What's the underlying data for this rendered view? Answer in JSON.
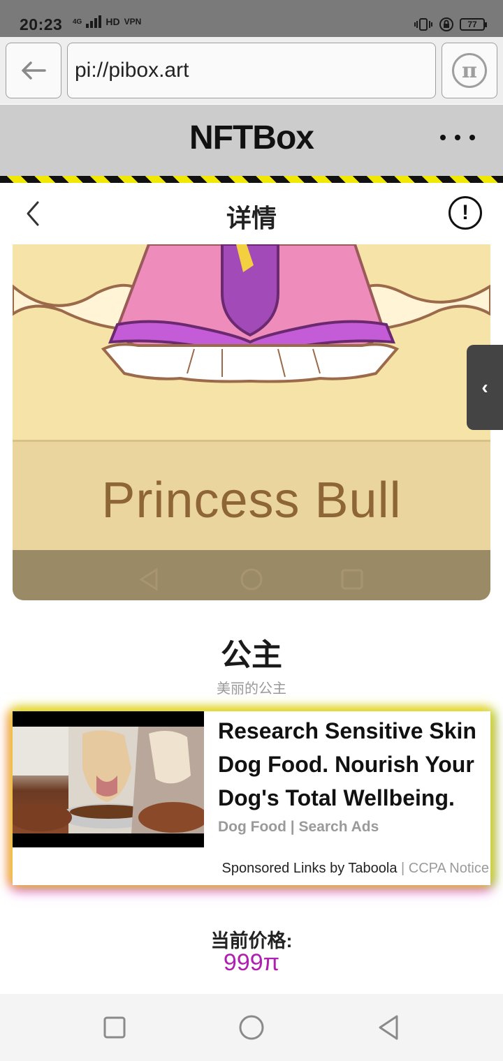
{
  "status_bar": {
    "time": "20:23",
    "network": "4G",
    "hd": "HD",
    "vpn": "VPN",
    "battery": "77"
  },
  "browser": {
    "url": "pi://pibox.art",
    "back_icon": "arrow-left-icon",
    "pi_icon": "pi-logo-icon",
    "pi_symbol": "π"
  },
  "app_header": {
    "title": "NFTBox",
    "more_icon": "more-dots-icon"
  },
  "page_header": {
    "title": "详情",
    "info_symbol": "!"
  },
  "nft": {
    "image_caption": "Princess Bull",
    "handle_symbol": "‹",
    "name": "公主",
    "description": "美丽的公主"
  },
  "ad": {
    "headline": "Research Sensitive Skin Dog Food. Nourish Your Dog's Total Wellbeing.",
    "source": "Dog Food | Search Ads",
    "sponsor": "Sponsored Links by Taboola",
    "separator": " | ",
    "ccpa": "CCPA Notice"
  },
  "price": {
    "label": "当前价格:",
    "value": "999π"
  },
  "colors": {
    "accent_price": "#b020b0",
    "hazard_yellow": "#f0e800",
    "header_bg": "#cccccc"
  }
}
